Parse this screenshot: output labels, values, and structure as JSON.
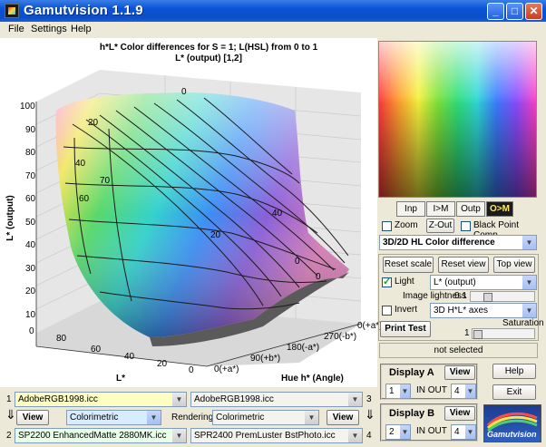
{
  "window": {
    "title": "Gamutvision 1.1.9",
    "min": "_",
    "max": "□",
    "close": "✕"
  },
  "menu": [
    "File",
    "Settings",
    "Help"
  ],
  "plot": {
    "title_line1": "h*L* Color differences for S = 1;  L(HSL) from 0 to 1",
    "title_line2": "L* (output)  [1,2]",
    "z_axis_label": "L* (output)",
    "z_ticks": [
      "100",
      "90",
      "80",
      "70",
      "60",
      "50",
      "40",
      "30",
      "20",
      "10",
      "0"
    ],
    "l_axis_label": "L*",
    "l_ticks": [
      "80",
      "60",
      "40",
      "20",
      "0"
    ],
    "h_axis_label": "Hue h* (Angle)",
    "h_ticks": [
      "0(+a*)",
      "270(-b*)",
      "180(-a*)",
      "90(+b*)",
      "0(+a*)"
    ],
    "contour_labels": [
      "0",
      "0",
      "0",
      "20",
      "40",
      "60",
      "70",
      "0",
      "40",
      "40",
      "20",
      "10",
      "0",
      "0",
      "40",
      "60",
      "80",
      "0"
    ]
  },
  "view_buttons": [
    {
      "label": "Inp",
      "active": false
    },
    {
      "label": "I>M",
      "active": false
    },
    {
      "label": "Outp",
      "active": false
    },
    {
      "label": "O>M",
      "active": true
    }
  ],
  "zoom": {
    "label": "Zoom",
    "checked": false
  },
  "zout": "Z-Out",
  "bpc": {
    "label": "Black Point Comp.",
    "checked": false
  },
  "display_type": "3D/2D HL Color difference",
  "reset_scale": "Reset scale",
  "reset_view": "Reset view",
  "top_view": "Top view",
  "light": {
    "label": "Light",
    "checked": true,
    "value": "L* (output)"
  },
  "image_lightness": {
    "label": "Image lightness",
    "value": "0.1",
    "fraction": 0.1
  },
  "invert": {
    "label": "Invert",
    "checked": false,
    "value": "3D H*L* axes"
  },
  "print_test": "Print Test",
  "saturation": {
    "label": "Saturation",
    "value": "1",
    "fraction": 0.0
  },
  "status": "not selected",
  "display_a": {
    "label": "Display A",
    "view": "View",
    "in": "1",
    "io_label": "IN  OUT",
    "out": "4"
  },
  "display_b": {
    "label": "Display B",
    "view": "View",
    "in": "2",
    "io_label": "IN  OUT",
    "out": "4"
  },
  "help": "Help",
  "exit": "Exit",
  "logo_text": "Gamutvision",
  "files": {
    "n1": "1",
    "f1": "AdobeRGB1998.icc",
    "n3": "3",
    "f3": "AdobeRGB1998.icc",
    "view_left": "View",
    "intent_left": "Colorimetric",
    "rendering_label": "Rendering",
    "intent_right": "Colorimetric",
    "view_right": "View",
    "n2": "2",
    "f2": "SP2200 EnhancedMatte 2880MK.icc",
    "n4": "4",
    "f4": "SPR2400 PremLuster BstPhoto.icc"
  }
}
